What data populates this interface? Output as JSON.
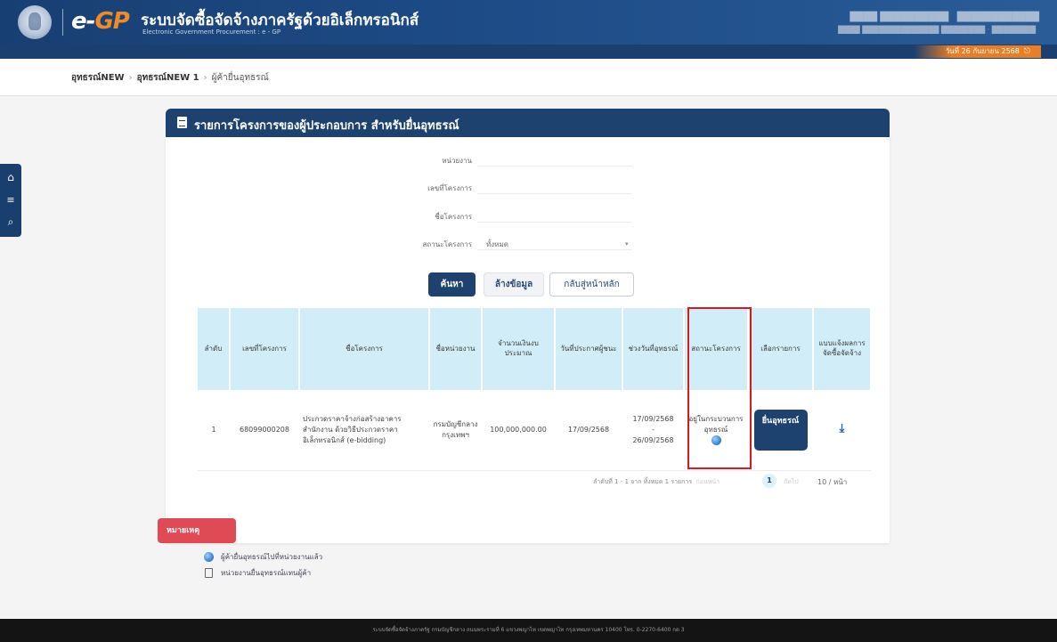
{
  "header": {
    "logo_e": "e-",
    "logo_gp": "GP",
    "site_title": "ระบบจัดซื้อจัดจ้างภาครัฐด้วยอิเล็กทรอนิกส์",
    "site_subtitle": "Electronic Government Procurement : e - GP",
    "date_label": "วันที่ 26 กันยายน 2568"
  },
  "breadcrumb": [
    "อุทธรณ์NEW",
    "อุทธรณ์NEW 1",
    "ผู้ค้ายื่นอุทธรณ์"
  ],
  "card": {
    "title": "รายการโครงการของผู้ประกอบการ สำหรับยื่นอุทธรณ์"
  },
  "form": {
    "agency_label": "หน่วยงาน",
    "project_no_label": "เลขที่โครงการ",
    "project_name_label": "ชื่อโครงการ",
    "status_label": "สถานะโครงการ",
    "status_value": "ทั้งหมด"
  },
  "buttons": {
    "search": "ค้นหา",
    "clear": "ล้างข้อมูล",
    "back": "กลับสู่หน้าหลัก"
  },
  "table": {
    "headers": {
      "seq": "ลำดับ",
      "project_no": "เลขที่โครงการ",
      "project_name": "ชื่อโครงการ",
      "agency": "ชื่อหน่วยงาน",
      "budget": "จำนวนเงินงบประมาณ",
      "announce_date": "วันที่ประกาศผู้ชนะ",
      "appeal_period": "ช่วงวันที่อุทธรณ์",
      "project_status": "สถานะโครงการ",
      "select": "เลือกรายการ",
      "form": "แบบแจ้งผลการจัดซื้อจัดจ้าง"
    },
    "rows": [
      {
        "seq": "1",
        "project_no": "68099000208",
        "project_name": "ประกวดราคาจ้างก่อสร้างอาคารสำนักงาน ด้วยวิธีประกวดราคาอิเล็กทรอนิกส์ (e-bidding)",
        "agency": "กรมบัญชีกลาง กรุงเทพฯ",
        "budget": "100,000,000.00",
        "announce_date": "17/09/2568",
        "appeal_start": "17/09/2568",
        "appeal_dash": "-",
        "appeal_end": "26/09/2568",
        "status": "อยู่ในกระบวนการอุทธรณ์",
        "action": "ยื่นอุทธรณ์"
      }
    ]
  },
  "pagination": {
    "summary": "ลำดับที่ 1 - 1 จาก ทั้งหมด 1 รายการ",
    "prev": "ก่อนหน้า",
    "current": "1",
    "next": "ถัดไป",
    "page_size": "10 / หน้า"
  },
  "remarks": {
    "tag": "หมายเหตุ",
    "items": [
      "ผู้ค้ายื่นอุทธรณ์ไปที่หน่วยงานแล้ว",
      "หน่วยงานยื่นอุทธรณ์แทนผู้ค้า"
    ]
  },
  "footer": {
    "text": "ระบบจัดซื้อจัดจ้างภาครัฐ กรมบัญชีกลาง ถนนพระรามที่ 6 แขวงพญาไท เขตพญาไท กรุงเทพมหานคร 10400 โทร. 0-2270-6400 กด 3"
  },
  "colors": {
    "brand_navy": "#1d4270",
    "accent_orange": "#e97e24",
    "table_header": "#d1eef8",
    "highlight_red": "#d71920",
    "remark_red": "#e04a55"
  },
  "icons": [
    "home-icon",
    "menu-icon",
    "search-icon",
    "document-icon",
    "download-icon",
    "globe-icon",
    "logout-icon"
  ]
}
